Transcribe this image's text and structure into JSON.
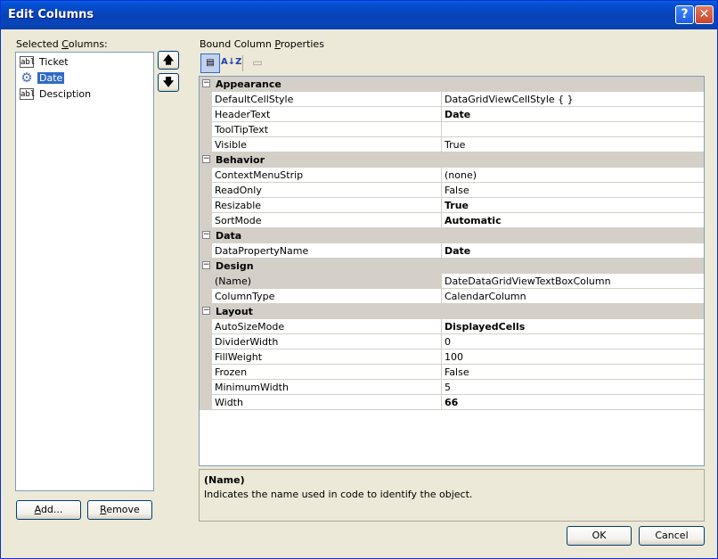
{
  "window": {
    "title": "Edit Columns",
    "help_glyph": "?",
    "close_glyph": "✕"
  },
  "left": {
    "label_pre": "Selected ",
    "label_accel": "C",
    "label_post": "olumns:",
    "items": [
      {
        "label": "Ticket",
        "icon": "textbox-icon",
        "icon_text": "abl"
      },
      {
        "label": "Date",
        "icon": "gear-icon",
        "icon_text": "⚙"
      },
      {
        "label": "Desciption",
        "icon": "textbox-icon",
        "icon_text": "abl"
      }
    ],
    "selected_index": 1,
    "move_up_glyph": "🡅",
    "move_down_glyph": "🡇",
    "add_pre": "",
    "add_accel": "A",
    "add_post": "dd...",
    "remove_pre": "",
    "remove_accel": "R",
    "remove_post": "emove"
  },
  "right": {
    "label_pre": "Bound Column ",
    "label_accel": "P",
    "label_post": "roperties",
    "toolbar": {
      "categorized_glyph": "▤",
      "alphabetical_glyph": "A↓Z",
      "property_pages_glyph": "▭"
    },
    "categories": [
      {
        "name": "Appearance",
        "toggle": "−",
        "props": [
          {
            "name": "DefaultCellStyle",
            "value": "DataGridViewCellStyle { }",
            "bold": false
          },
          {
            "name": "HeaderText",
            "value": "Date",
            "bold": true
          },
          {
            "name": "ToolTipText",
            "value": "",
            "bold": false
          },
          {
            "name": "Visible",
            "value": "True",
            "bold": false
          }
        ]
      },
      {
        "name": "Behavior",
        "toggle": "−",
        "props": [
          {
            "name": "ContextMenuStrip",
            "value": "(none)",
            "bold": false
          },
          {
            "name": "ReadOnly",
            "value": "False",
            "bold": false
          },
          {
            "name": "Resizable",
            "value": "True",
            "bold": true
          },
          {
            "name": "SortMode",
            "value": "Automatic",
            "bold": true
          }
        ]
      },
      {
        "name": "Data",
        "toggle": "−",
        "props": [
          {
            "name": "DataPropertyName",
            "value": "Date",
            "bold": true
          }
        ]
      },
      {
        "name": "Design",
        "toggle": "−",
        "props": [
          {
            "name": "(Name)",
            "value": "DateDataGridViewTextBoxColumn",
            "bold": false,
            "selected": true
          },
          {
            "name": "ColumnType",
            "value": "CalendarColumn",
            "bold": false
          }
        ]
      },
      {
        "name": "Layout",
        "toggle": "−",
        "props": [
          {
            "name": "AutoSizeMode",
            "value": "DisplayedCells",
            "bold": true
          },
          {
            "name": "DividerWidth",
            "value": "0",
            "bold": false
          },
          {
            "name": "FillWeight",
            "value": "100",
            "bold": false
          },
          {
            "name": "Frozen",
            "value": "False",
            "bold": false
          },
          {
            "name": "MinimumWidth",
            "value": "5",
            "bold": false
          },
          {
            "name": "Width",
            "value": "66",
            "bold": true
          }
        ]
      }
    ],
    "description": {
      "title": "(Name)",
      "text": "Indicates the name used in code to identify the object."
    }
  },
  "footer": {
    "ok_label": "OK",
    "cancel_label": "Cancel"
  },
  "colors": {
    "title_bar": "#0842b8",
    "selection": "#316ac5",
    "category_bg": "#d4d0c8",
    "dialog_bg": "#ece9d8"
  }
}
